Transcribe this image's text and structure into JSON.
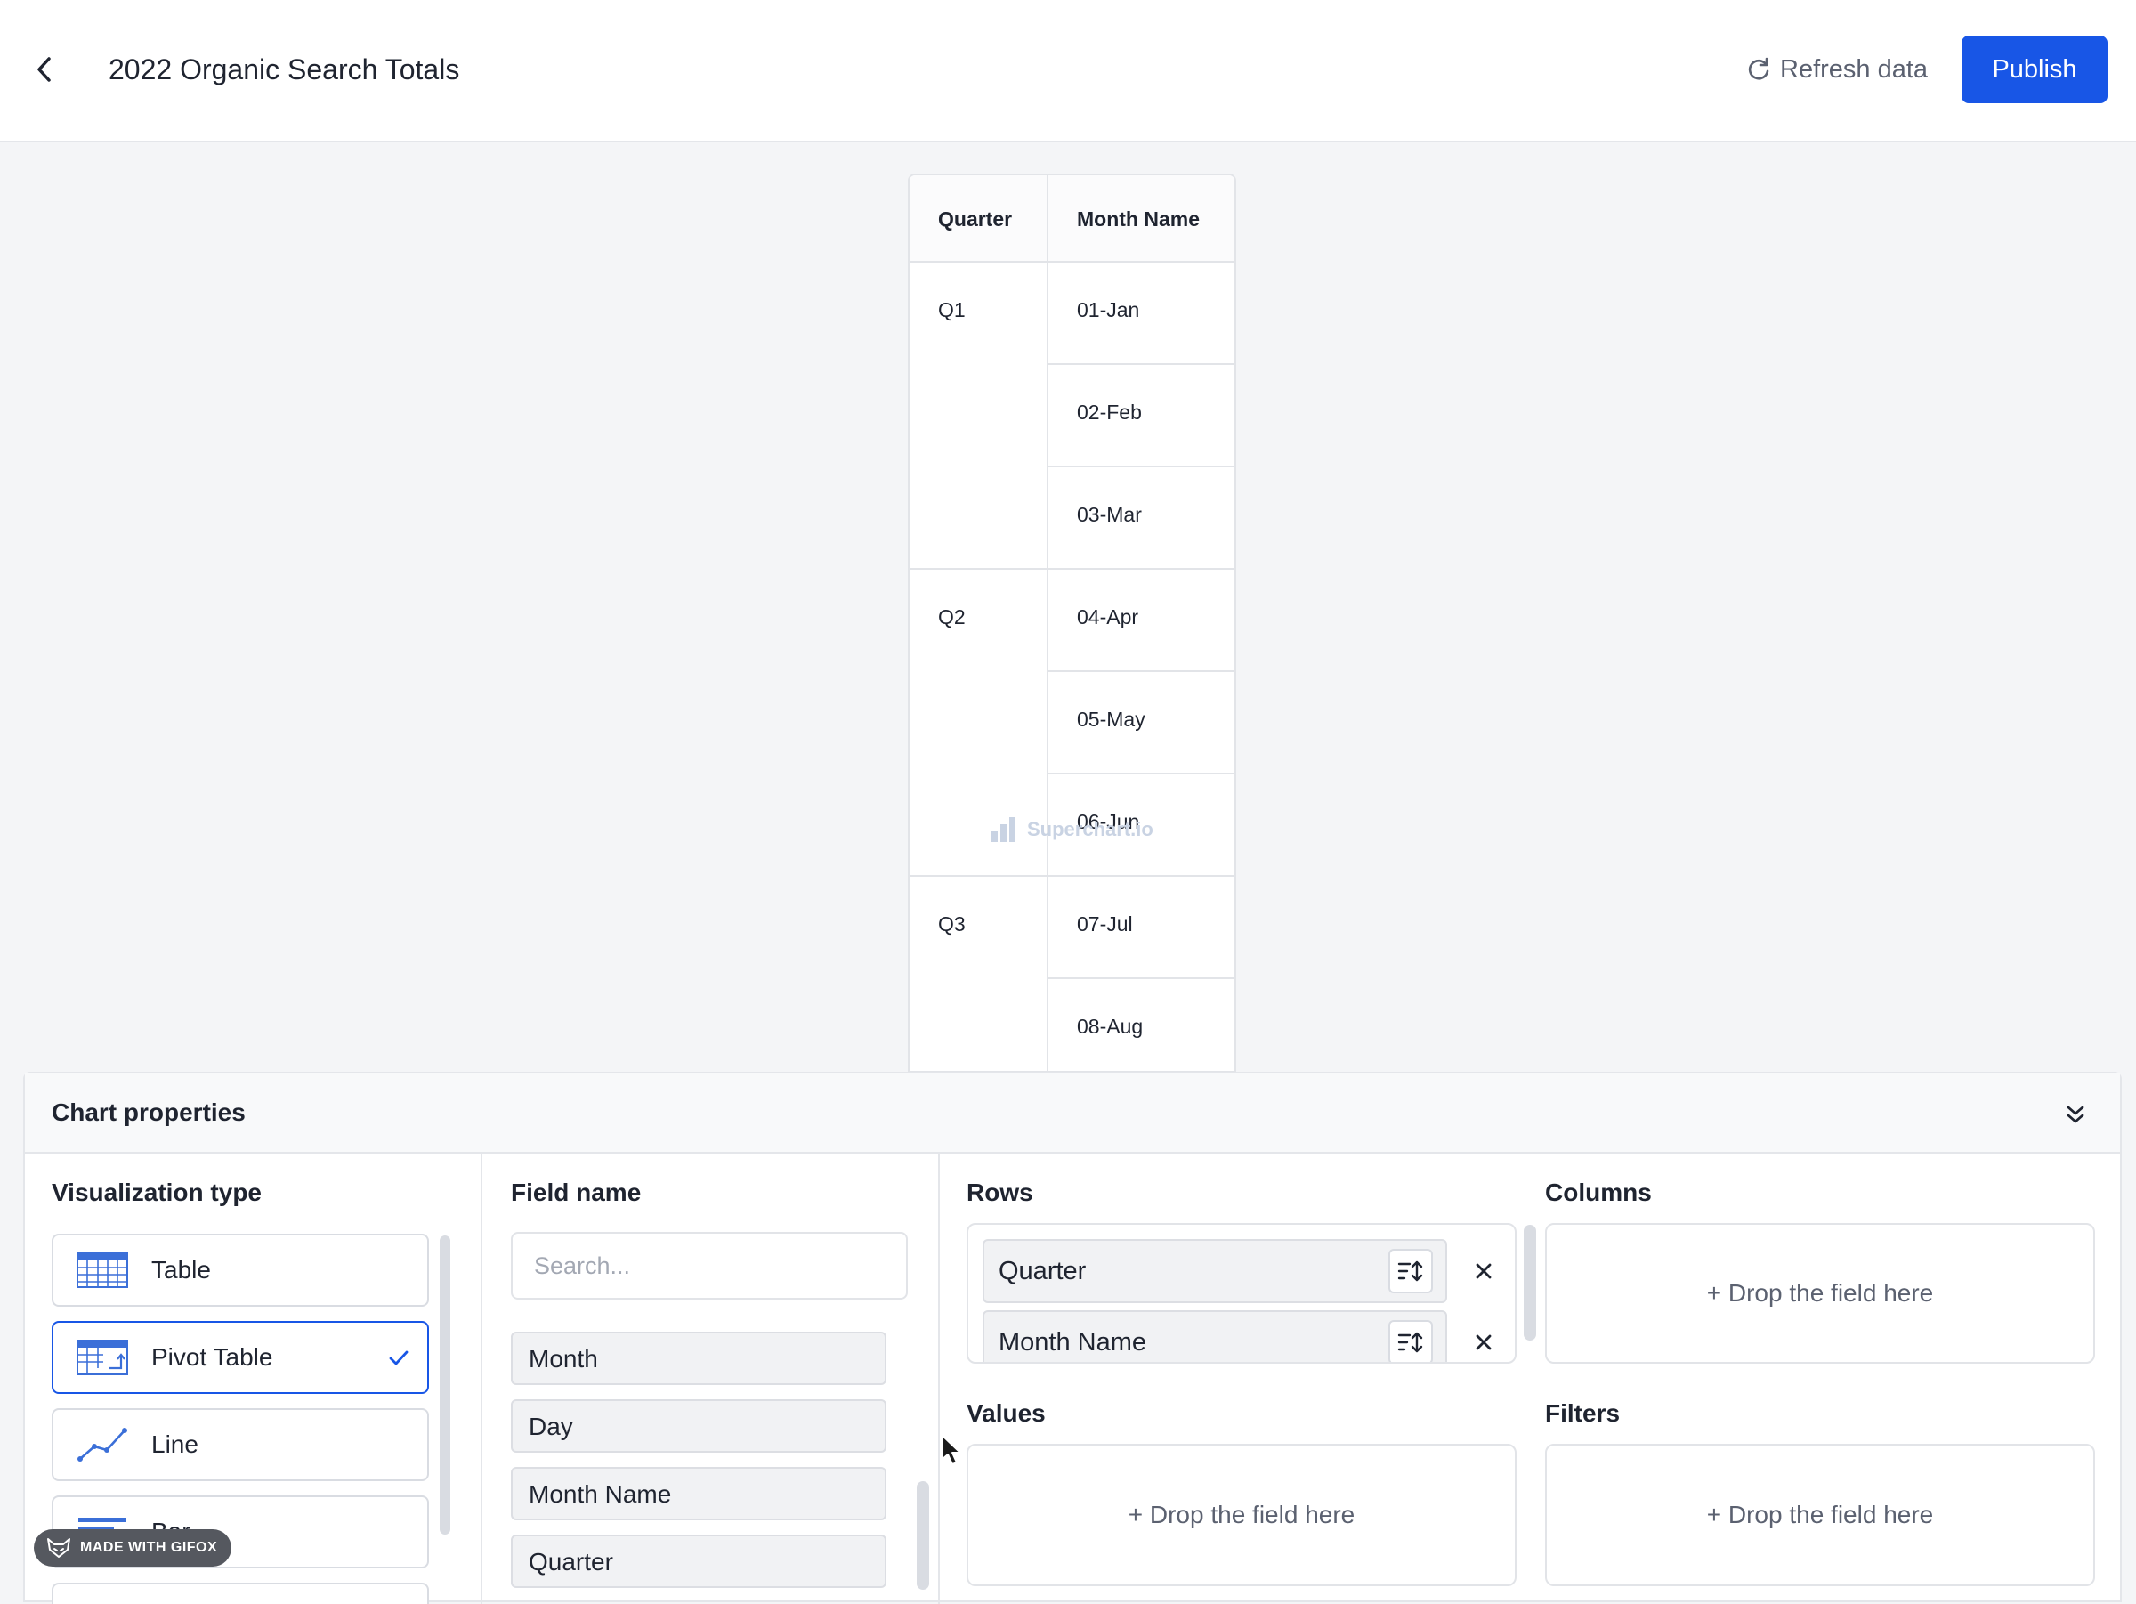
{
  "header": {
    "back_icon": "chevron-left-icon",
    "title": "2022 Organic Search Totals",
    "refresh_label": "Refresh data",
    "refresh_icon": "refresh-icon",
    "publish_label": "Publish",
    "accent_color": "#1856e6"
  },
  "pivot_table": {
    "columns": [
      "Quarter",
      "Month Name"
    ],
    "groups": [
      {
        "quarter": "Q1",
        "months": [
          "01-Jan",
          "02-Feb",
          "03-Mar"
        ]
      },
      {
        "quarter": "Q2",
        "months": [
          "04-Apr",
          "05-May",
          "06-Jun"
        ]
      },
      {
        "quarter": "Q3",
        "months": [
          "07-Jul",
          "08-Aug"
        ]
      }
    ],
    "watermark": "Superchart.io"
  },
  "chart_properties": {
    "title": "Chart properties",
    "collapse_icon": "double-chevron-down-icon",
    "visualization": {
      "title": "Visualization type",
      "types": [
        {
          "label": "Table",
          "icon": "table-icon",
          "selected": false
        },
        {
          "label": "Pivot Table",
          "icon": "pivot-table-icon",
          "selected": true
        },
        {
          "label": "Line",
          "icon": "line-chart-icon",
          "selected": false
        },
        {
          "label": "Bar",
          "icon": "bar-chart-icon",
          "selected": false
        }
      ]
    },
    "fields": {
      "title": "Field name",
      "search_placeholder": "Search...",
      "items": [
        "Month",
        "Day",
        "Month Name",
        "Quarter"
      ]
    },
    "rows": {
      "title": "Rows",
      "items": [
        "Quarter",
        "Month Name"
      ]
    },
    "columns": {
      "title": "Columns",
      "drop_text": "+ Drop the field here"
    },
    "values": {
      "title": "Values",
      "drop_text": "+ Drop the field here"
    },
    "filters": {
      "title": "Filters",
      "drop_text": "+ Drop the field here"
    }
  },
  "badge": {
    "label": "MADE WITH GIFOX"
  }
}
